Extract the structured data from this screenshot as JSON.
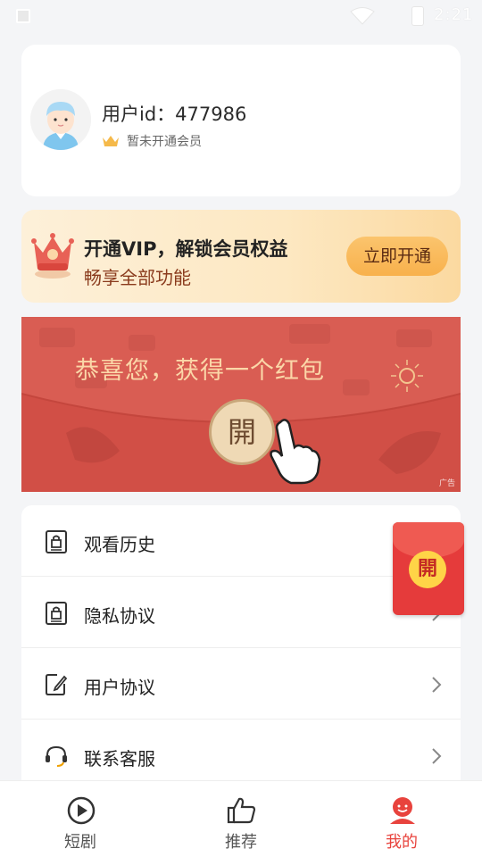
{
  "status_bar": {
    "time": "2:21"
  },
  "profile": {
    "user_id_text": "用户id：477986",
    "vip_status": "暂未开通会员"
  },
  "vip_banner": {
    "title": "开通VIP，解锁会员权益",
    "subtitle": "畅享全部功能",
    "button": "立即开通"
  },
  "red_packet_ad": {
    "title": "恭喜您，获得一个红包",
    "open_glyph": "開",
    "ad_label": "广告"
  },
  "menu": {
    "items": [
      {
        "label": "观看历史",
        "icon": "history-lock-icon"
      },
      {
        "label": "隐私协议",
        "icon": "privacy-lock-icon"
      },
      {
        "label": "用户协议",
        "icon": "edit-doc-icon"
      },
      {
        "label": "联系客服",
        "icon": "headset-icon"
      }
    ]
  },
  "floating_red_packet": {
    "glyph": "開"
  },
  "tabbar": {
    "tabs": [
      {
        "label": "短剧",
        "icon": "play-circle-icon",
        "active": false
      },
      {
        "label": "推荐",
        "icon": "thumbs-up-icon",
        "active": false
      },
      {
        "label": "我的",
        "icon": "profile-face-icon",
        "active": true
      }
    ]
  },
  "colors": {
    "accent": "#e8433d",
    "vip_gold": "#f8b14c",
    "red_packet": "#d95d53"
  }
}
